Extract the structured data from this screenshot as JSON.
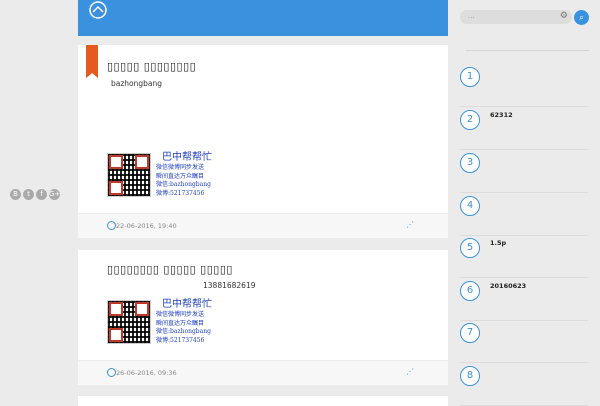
{
  "header": {
    "logo": "logo-icon"
  },
  "social": [
    "B",
    "t",
    "f",
    "G+"
  ],
  "posts": [
    {
      "title": "▯▯▯▯▯ ▯▯▯▯▯▯▯▯",
      "body": "bazhongbang",
      "brand": {
        "name": "巴中帮帮忙",
        "lines": [
          "微信微博同步发送",
          "瞬间直达万众瞩目",
          "微信:bazhongbang",
          "微博:521737456"
        ]
      },
      "date": "22-06-2016, 19:40"
    },
    {
      "title": "▯▯▯▯▯▯▯▯ ▯▯▯▯▯ ▯▯▯▯▯",
      "body": "13881682619",
      "brand": {
        "name": "巴中帮帮忙",
        "lines": [
          "微信微博同步发送",
          "瞬间直达万众瞩目",
          "微信:bazhongbang",
          "微博:521737456"
        ]
      },
      "date": "26-06-2016, 09:36"
    }
  ],
  "sidebar": {
    "search_placeholder": "...",
    "items": [
      {
        "num": "1",
        "text": ""
      },
      {
        "num": "2",
        "text": "62312"
      },
      {
        "num": "3",
        "text": ""
      },
      {
        "num": "4",
        "text": ""
      },
      {
        "num": "5",
        "text": "1.5p"
      },
      {
        "num": "6",
        "text": "20160623"
      },
      {
        "num": "7",
        "text": ""
      },
      {
        "num": "8",
        "text": ""
      }
    ]
  },
  "colors": {
    "accent": "#3a92de",
    "bookmark": "#e55a1f"
  }
}
